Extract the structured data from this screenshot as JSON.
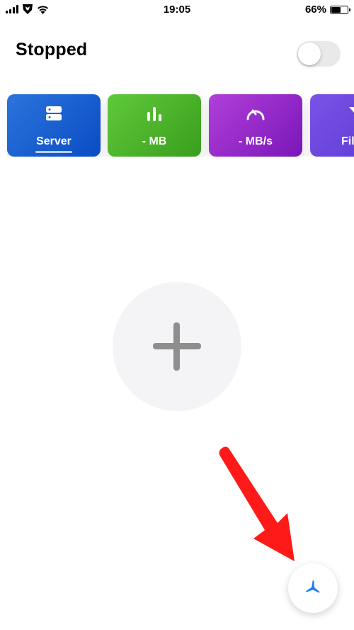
{
  "status_bar": {
    "time": "19:05",
    "battery_percent": "66%",
    "battery_level": 0.66,
    "icons": [
      "signal-icon",
      "transformers-logo-icon",
      "wifi-icon",
      "battery-icon"
    ]
  },
  "header": {
    "title": "Stopped",
    "toggle_on": false
  },
  "cards": [
    {
      "label": "Server",
      "icon": "server-icon",
      "color": "#1f63d4",
      "selected": true
    },
    {
      "label": "- MB",
      "icon": "bar-chart-icon",
      "color": "#4cb52b",
      "selected": false
    },
    {
      "label": "- MB/s",
      "icon": "speedometer-icon",
      "color": "#9a28c9",
      "selected": false
    },
    {
      "label": "Fil",
      "icon": "filter-icon",
      "color": "#6a46de",
      "selected": false
    }
  ],
  "add_button": {
    "icon": "plus-icon"
  },
  "fab": {
    "icon": "fan-icon",
    "color": "#1a7ef2"
  },
  "annotation": {
    "icon": "red-arrow-icon",
    "color": "#ff1a1a"
  }
}
